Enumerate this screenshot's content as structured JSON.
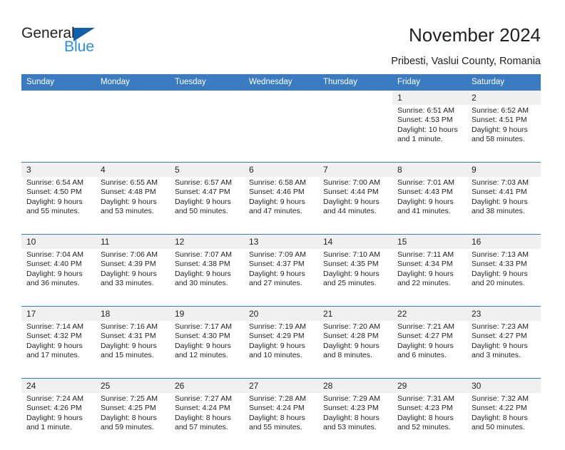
{
  "brand": {
    "name_part1": "General",
    "name_part2": "Blue",
    "triangle_color": "#1060aa",
    "blue_color": "#2b8ede"
  },
  "header": {
    "title": "November 2024",
    "subtitle": "Pribesti, Vaslui County, Romania"
  },
  "calendar": {
    "accent_color": "#3b7cc0",
    "date_band_color": "#f0f0f0",
    "weekdays": [
      "Sunday",
      "Monday",
      "Tuesday",
      "Wednesday",
      "Thursday",
      "Friday",
      "Saturday"
    ],
    "weeks": [
      [
        {
          "day": "",
          "sunrise": "",
          "sunset": "",
          "daylight_1": "",
          "daylight_2": "",
          "empty": true
        },
        {
          "day": "",
          "sunrise": "",
          "sunset": "",
          "daylight_1": "",
          "daylight_2": "",
          "empty": true
        },
        {
          "day": "",
          "sunrise": "",
          "sunset": "",
          "daylight_1": "",
          "daylight_2": "",
          "empty": true
        },
        {
          "day": "",
          "sunrise": "",
          "sunset": "",
          "daylight_1": "",
          "daylight_2": "",
          "empty": true
        },
        {
          "day": "",
          "sunrise": "",
          "sunset": "",
          "daylight_1": "",
          "daylight_2": "",
          "empty": true
        },
        {
          "day": "1",
          "sunrise": "Sunrise: 6:51 AM",
          "sunset": "Sunset: 4:53 PM",
          "daylight_1": "Daylight: 10 hours",
          "daylight_2": "and 1 minute."
        },
        {
          "day": "2",
          "sunrise": "Sunrise: 6:52 AM",
          "sunset": "Sunset: 4:51 PM",
          "daylight_1": "Daylight: 9 hours",
          "daylight_2": "and 58 minutes."
        }
      ],
      [
        {
          "day": "3",
          "sunrise": "Sunrise: 6:54 AM",
          "sunset": "Sunset: 4:50 PM",
          "daylight_1": "Daylight: 9 hours",
          "daylight_2": "and 55 minutes."
        },
        {
          "day": "4",
          "sunrise": "Sunrise: 6:55 AM",
          "sunset": "Sunset: 4:48 PM",
          "daylight_1": "Daylight: 9 hours",
          "daylight_2": "and 53 minutes."
        },
        {
          "day": "5",
          "sunrise": "Sunrise: 6:57 AM",
          "sunset": "Sunset: 4:47 PM",
          "daylight_1": "Daylight: 9 hours",
          "daylight_2": "and 50 minutes."
        },
        {
          "day": "6",
          "sunrise": "Sunrise: 6:58 AM",
          "sunset": "Sunset: 4:46 PM",
          "daylight_1": "Daylight: 9 hours",
          "daylight_2": "and 47 minutes."
        },
        {
          "day": "7",
          "sunrise": "Sunrise: 7:00 AM",
          "sunset": "Sunset: 4:44 PM",
          "daylight_1": "Daylight: 9 hours",
          "daylight_2": "and 44 minutes."
        },
        {
          "day": "8",
          "sunrise": "Sunrise: 7:01 AM",
          "sunset": "Sunset: 4:43 PM",
          "daylight_1": "Daylight: 9 hours",
          "daylight_2": "and 41 minutes."
        },
        {
          "day": "9",
          "sunrise": "Sunrise: 7:03 AM",
          "sunset": "Sunset: 4:41 PM",
          "daylight_1": "Daylight: 9 hours",
          "daylight_2": "and 38 minutes."
        }
      ],
      [
        {
          "day": "10",
          "sunrise": "Sunrise: 7:04 AM",
          "sunset": "Sunset: 4:40 PM",
          "daylight_1": "Daylight: 9 hours",
          "daylight_2": "and 36 minutes."
        },
        {
          "day": "11",
          "sunrise": "Sunrise: 7:06 AM",
          "sunset": "Sunset: 4:39 PM",
          "daylight_1": "Daylight: 9 hours",
          "daylight_2": "and 33 minutes."
        },
        {
          "day": "12",
          "sunrise": "Sunrise: 7:07 AM",
          "sunset": "Sunset: 4:38 PM",
          "daylight_1": "Daylight: 9 hours",
          "daylight_2": "and 30 minutes."
        },
        {
          "day": "13",
          "sunrise": "Sunrise: 7:09 AM",
          "sunset": "Sunset: 4:37 PM",
          "daylight_1": "Daylight: 9 hours",
          "daylight_2": "and 27 minutes."
        },
        {
          "day": "14",
          "sunrise": "Sunrise: 7:10 AM",
          "sunset": "Sunset: 4:35 PM",
          "daylight_1": "Daylight: 9 hours",
          "daylight_2": "and 25 minutes."
        },
        {
          "day": "15",
          "sunrise": "Sunrise: 7:11 AM",
          "sunset": "Sunset: 4:34 PM",
          "daylight_1": "Daylight: 9 hours",
          "daylight_2": "and 22 minutes."
        },
        {
          "day": "16",
          "sunrise": "Sunrise: 7:13 AM",
          "sunset": "Sunset: 4:33 PM",
          "daylight_1": "Daylight: 9 hours",
          "daylight_2": "and 20 minutes."
        }
      ],
      [
        {
          "day": "17",
          "sunrise": "Sunrise: 7:14 AM",
          "sunset": "Sunset: 4:32 PM",
          "daylight_1": "Daylight: 9 hours",
          "daylight_2": "and 17 minutes."
        },
        {
          "day": "18",
          "sunrise": "Sunrise: 7:16 AM",
          "sunset": "Sunset: 4:31 PM",
          "daylight_1": "Daylight: 9 hours",
          "daylight_2": "and 15 minutes."
        },
        {
          "day": "19",
          "sunrise": "Sunrise: 7:17 AM",
          "sunset": "Sunset: 4:30 PM",
          "daylight_1": "Daylight: 9 hours",
          "daylight_2": "and 12 minutes."
        },
        {
          "day": "20",
          "sunrise": "Sunrise: 7:19 AM",
          "sunset": "Sunset: 4:29 PM",
          "daylight_1": "Daylight: 9 hours",
          "daylight_2": "and 10 minutes."
        },
        {
          "day": "21",
          "sunrise": "Sunrise: 7:20 AM",
          "sunset": "Sunset: 4:28 PM",
          "daylight_1": "Daylight: 9 hours",
          "daylight_2": "and 8 minutes."
        },
        {
          "day": "22",
          "sunrise": "Sunrise: 7:21 AM",
          "sunset": "Sunset: 4:27 PM",
          "daylight_1": "Daylight: 9 hours",
          "daylight_2": "and 6 minutes."
        },
        {
          "day": "23",
          "sunrise": "Sunrise: 7:23 AM",
          "sunset": "Sunset: 4:27 PM",
          "daylight_1": "Daylight: 9 hours",
          "daylight_2": "and 3 minutes."
        }
      ],
      [
        {
          "day": "24",
          "sunrise": "Sunrise: 7:24 AM",
          "sunset": "Sunset: 4:26 PM",
          "daylight_1": "Daylight: 9 hours",
          "daylight_2": "and 1 minute."
        },
        {
          "day": "25",
          "sunrise": "Sunrise: 7:25 AM",
          "sunset": "Sunset: 4:25 PM",
          "daylight_1": "Daylight: 8 hours",
          "daylight_2": "and 59 minutes."
        },
        {
          "day": "26",
          "sunrise": "Sunrise: 7:27 AM",
          "sunset": "Sunset: 4:24 PM",
          "daylight_1": "Daylight: 8 hours",
          "daylight_2": "and 57 minutes."
        },
        {
          "day": "27",
          "sunrise": "Sunrise: 7:28 AM",
          "sunset": "Sunset: 4:24 PM",
          "daylight_1": "Daylight: 8 hours",
          "daylight_2": "and 55 minutes."
        },
        {
          "day": "28",
          "sunrise": "Sunrise: 7:29 AM",
          "sunset": "Sunset: 4:23 PM",
          "daylight_1": "Daylight: 8 hours",
          "daylight_2": "and 53 minutes."
        },
        {
          "day": "29",
          "sunrise": "Sunrise: 7:31 AM",
          "sunset": "Sunset: 4:23 PM",
          "daylight_1": "Daylight: 8 hours",
          "daylight_2": "and 52 minutes."
        },
        {
          "day": "30",
          "sunrise": "Sunrise: 7:32 AM",
          "sunset": "Sunset: 4:22 PM",
          "daylight_1": "Daylight: 8 hours",
          "daylight_2": "and 50 minutes."
        }
      ]
    ]
  }
}
